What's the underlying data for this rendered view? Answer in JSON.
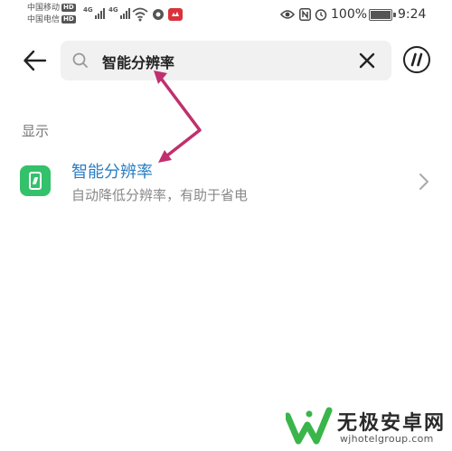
{
  "status_bar": {
    "carrier_1": "中国移动",
    "carrier_2": "中国电信",
    "hd_badge": "HD",
    "network_label": "4G",
    "battery": "100%",
    "time": "9:24",
    "icons": [
      "signal-icon",
      "wifi-icon",
      "notification-app-icon",
      "eye-comfort-icon",
      "nfc-icon",
      "alarm-icon",
      "battery-icon"
    ]
  },
  "header": {
    "search_value": "智能分辨率",
    "icons": [
      "back-arrow-icon",
      "search-icon",
      "clear-icon",
      "ai-assistant-icon"
    ]
  },
  "section": {
    "label": "显示"
  },
  "results": [
    {
      "title": "智能分辨率",
      "description": "自动降低分辨率，有助于省电",
      "icon": "screen-resolution-icon"
    }
  ],
  "watermark": {
    "name": "无极安卓网",
    "url": "wjhotelgroup.com"
  },
  "colors": {
    "accent_blue": "#2a7dc4",
    "app_icon_green": "#33c16b",
    "annotation_arrow": "#c0306e",
    "search_bg": "#f1f1f1",
    "watermark_green": "#3ab54a"
  }
}
